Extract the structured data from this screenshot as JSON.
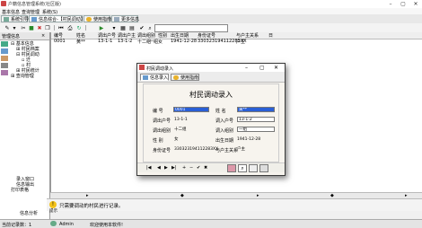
{
  "window": {
    "title": "户籍信息管理系统(社区版)",
    "min": "–",
    "max": "▢",
    "close": "✕"
  },
  "menu": [
    "基本信息",
    "查询管理",
    "系统(S)"
  ],
  "tabs": [
    {
      "label": "系统引导",
      "active": false
    },
    {
      "label": "信息综合-【村民调动】",
      "active": true
    },
    {
      "label": "使用指南",
      "active": false
    },
    {
      "label": "更多信息",
      "active": false
    }
  ],
  "tree": {
    "header": "管理信息",
    "items": [
      {
        "label": "基本信息",
        "level": 0
      },
      {
        "label": "村民档案",
        "level": 1
      },
      {
        "label": "村民调动",
        "level": 1
      },
      {
        "label": "迁",
        "level": 2
      },
      {
        "label": "村",
        "level": 2
      },
      {
        "label": "村民统计",
        "level": 1
      },
      {
        "label": "查询管理",
        "level": 0
      }
    ],
    "bottom_items": [
      "录入窗口",
      "信息输出",
      "打印表格"
    ],
    "status_label": "信息分析"
  },
  "grid": {
    "columns": [
      "编号",
      "姓名",
      "调出户号",
      "调出户主",
      "调出组别",
      "性别",
      "出生日期",
      "身份证号",
      "与户主关系",
      "日"
    ],
    "rows": [
      [
        "0001",
        "黄**",
        "13-1-1",
        "13-1-2",
        "十二组",
        "一组",
        "女",
        "1941-12-28",
        "330323194112283XX",
        "户主"
      ]
    ]
  },
  "hint": {
    "text": "只需要调动的村民进行记录。",
    "prefix": "提示"
  },
  "status": {
    "left": "当前记录数：1",
    "user": "Admin",
    "welcome": "欢迎使用本软件!"
  },
  "dialog": {
    "title": "村民调动录入",
    "tabs": [
      "信息录入",
      "使用指南"
    ],
    "heading": "村民调动录入",
    "fields": {
      "id_label": "编 号",
      "id_value": "0001",
      "name_label": "姓 名",
      "name_value": "黄**",
      "out_house_label": "调出户号",
      "out_house_value": "13-1-1",
      "in_house_label": "调入户号",
      "in_house_value": "13-1-2",
      "out_group_label": "调出组别",
      "out_group_value": "十二组",
      "in_group_label": "调入组别",
      "in_group_value": "一组",
      "gender_label": "性 别",
      "gender_value": "女",
      "birth_label": "出生日期",
      "birth_value": "1941-12-28",
      "idcard_label": "身份证号",
      "idcard_value": "330323194112283XX",
      "relation_label": "与户主关系",
      "relation_value": "户主"
    },
    "nav": [
      "|◀",
      "◀",
      "▶",
      "▶|",
      "+",
      "−",
      "✔",
      "✖"
    ]
  },
  "colors": {
    "accent": "#2a5fd6",
    "dialog_bg": "#f7f4ee"
  }
}
